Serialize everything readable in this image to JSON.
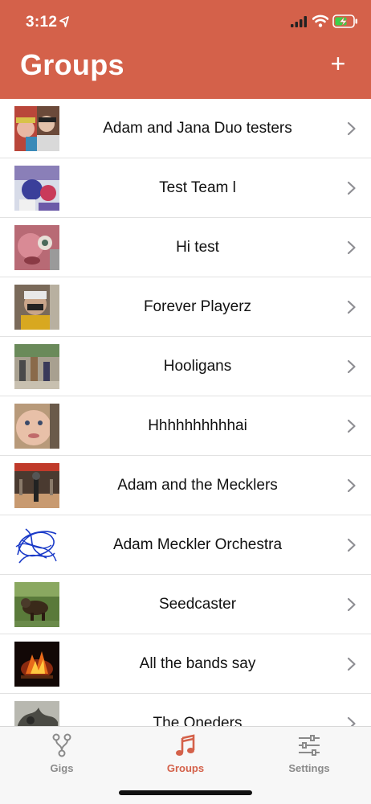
{
  "status_bar": {
    "time": "3:12"
  },
  "header": {
    "title": "Groups",
    "add_label": "+"
  },
  "groups": [
    {
      "name": "Adam and Jana Duo testers"
    },
    {
      "name": "Test Team l"
    },
    {
      "name": "Hi test"
    },
    {
      "name": "Forever Playerz"
    },
    {
      "name": "Hooligans"
    },
    {
      "name": "Hhhhhhhhhhai"
    },
    {
      "name": "Adam and the Mecklers"
    },
    {
      "name": "Adam Meckler Orchestra"
    },
    {
      "name": "Seedcaster"
    },
    {
      "name": "All the bands say"
    },
    {
      "name": "The Oneders"
    }
  ],
  "tabbar": {
    "tabs": [
      {
        "label": "Gigs",
        "icon": "fork-icon",
        "active": false
      },
      {
        "label": "Groups",
        "icon": "music-note-icon",
        "active": true
      },
      {
        "label": "Settings",
        "icon": "sliders-icon",
        "active": false
      }
    ]
  },
  "colors": {
    "accent": "#d4614a",
    "inactive": "#8a8a8a"
  }
}
